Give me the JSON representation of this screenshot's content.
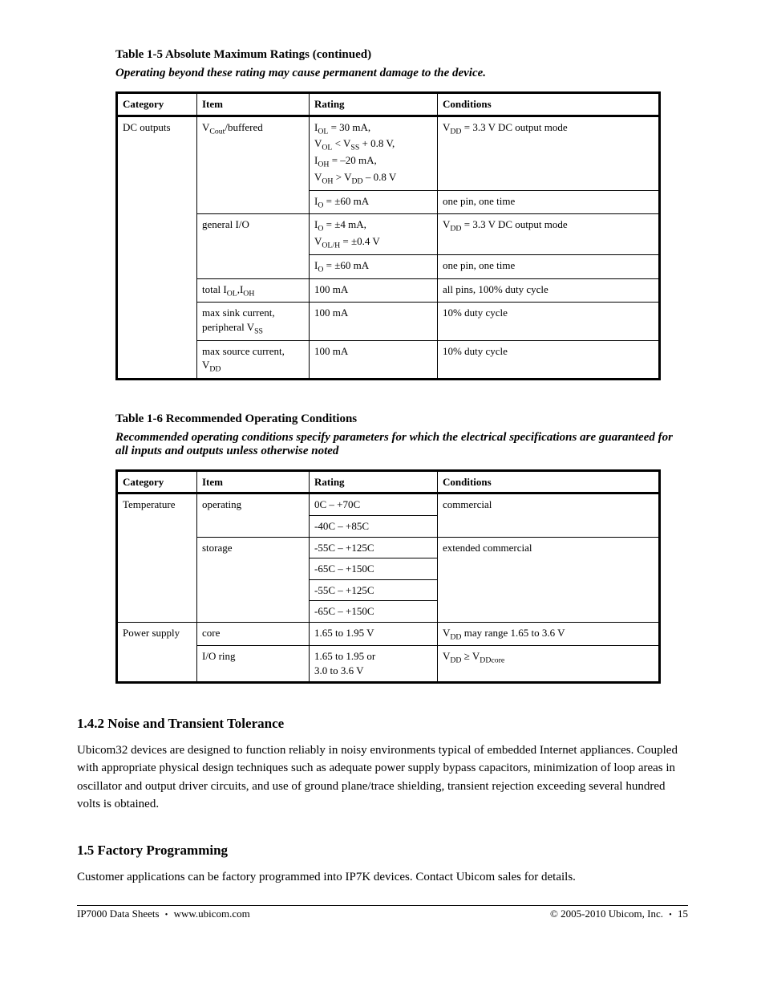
{
  "table1": {
    "heading": "Table 1-5 Absolute Maximum Ratings (continued)",
    "subtitle": "Operating beyond these rating may cause permanent damage to the device.",
    "headers": [
      "Category",
      "Item",
      "Rating",
      "Conditions"
    ],
    "rows": [
      {
        "category": "DC outputs",
        "item": "VCout/buffered",
        "ratings": [
          {
            "rating": "IOL = 30 mA,\nVOL < VSS + 0.8 V,\nIOH = –20 mA,\nVOH > VDD – 0.8 V",
            "cond": "VDD = 3.3 V DC output mode"
          },
          {
            "rating": "IO = ±60 mA",
            "cond": "one pin, one time"
          }
        ]
      },
      {
        "category": "",
        "item": "general I/O",
        "ratings": [
          {
            "rating": "IO = ±4 mA,\nVOL/H = ±0.4 V",
            "cond": "VDD = 3.3 V DC output mode"
          },
          {
            "rating": "IO = ±60 mA",
            "cond": "one pin, one time"
          }
        ]
      },
      {
        "category": "",
        "item": "total IOL,IOH",
        "ratings": [
          {
            "rating": "100 mA",
            "cond": "all pins, 100% duty cycle"
          }
        ]
      },
      {
        "category": "",
        "item": "max sink current, peripheral VSS",
        "ratings": [
          {
            "rating": "100 mA",
            "cond": "10% duty cycle"
          }
        ]
      },
      {
        "category": "",
        "item": "max source current, VDD",
        "ratings": [
          {
            "rating": "100 mA",
            "cond": "10% duty cycle"
          }
        ]
      }
    ]
  },
  "table2": {
    "heading": "Table 1-6 Recommended Operating Conditions",
    "subtitle": "Recommended operating conditions specify parameters for which the electrical specifications are guaranteed for all inputs and outputs unless otherwise noted",
    "headers": [
      "Category",
      "Item",
      "Rating",
      "Conditions"
    ],
    "rows": [
      {
        "category": "Temperature",
        "item": "operating",
        "ratings": [
          {
            "rating": "0C – +70C",
            "cond": "commercial"
          },
          {
            "rating": "-40C – +85C",
            "cond": ""
          }
        ],
        "mergeCond": true
      },
      {
        "category": "",
        "item": "storage",
        "ratings": [
          {
            "rating": "-55C – +125C",
            "cond": "extended commercial"
          },
          {
            "rating": "-65C – +150C",
            "cond": ""
          },
          {
            "rating": "-55C – +125C",
            "cond": ""
          },
          {
            "rating": "-65C – +150C",
            "cond": ""
          }
        ],
        "mergeCond": true
      },
      {
        "category": "Power supply",
        "item": "core",
        "ratings": [
          {
            "rating": "1.65 to 1.95 V",
            "cond": "VDD may range 1.65 to 3.6 V"
          }
        ]
      },
      {
        "category": "",
        "item": "I/O ring",
        "ratings": [
          {
            "rating": "1.65 to 1.95 or\n3.0 to 3.6 V",
            "cond": "VDD ≥ VDDcore"
          }
        ]
      }
    ]
  },
  "sections": {
    "noise": {
      "title": "1.4.2 Noise and Transient Tolerance",
      "text": "Ubicom32 devices are designed to function reliably in noisy environments typical of embedded Internet appliances. Coupled with appropriate physical design techniques such as adequate power supply bypass capacitors, minimization of loop areas in oscillator and output driver circuits, and use of ground plane/trace shielding, transient rejection exceeding several hundred volts is obtained."
    },
    "factory": {
      "title": "1.5 Factory Programming",
      "text": "Customer applications can be factory programmed into IP7K devices. Contact Ubicom sales for details."
    }
  },
  "footer": {
    "left": "IP7000 Data Sheets",
    "center": "www.ubicom.com",
    "right": "15",
    "copyright": "© 2005-2010 Ubicom, Inc."
  }
}
